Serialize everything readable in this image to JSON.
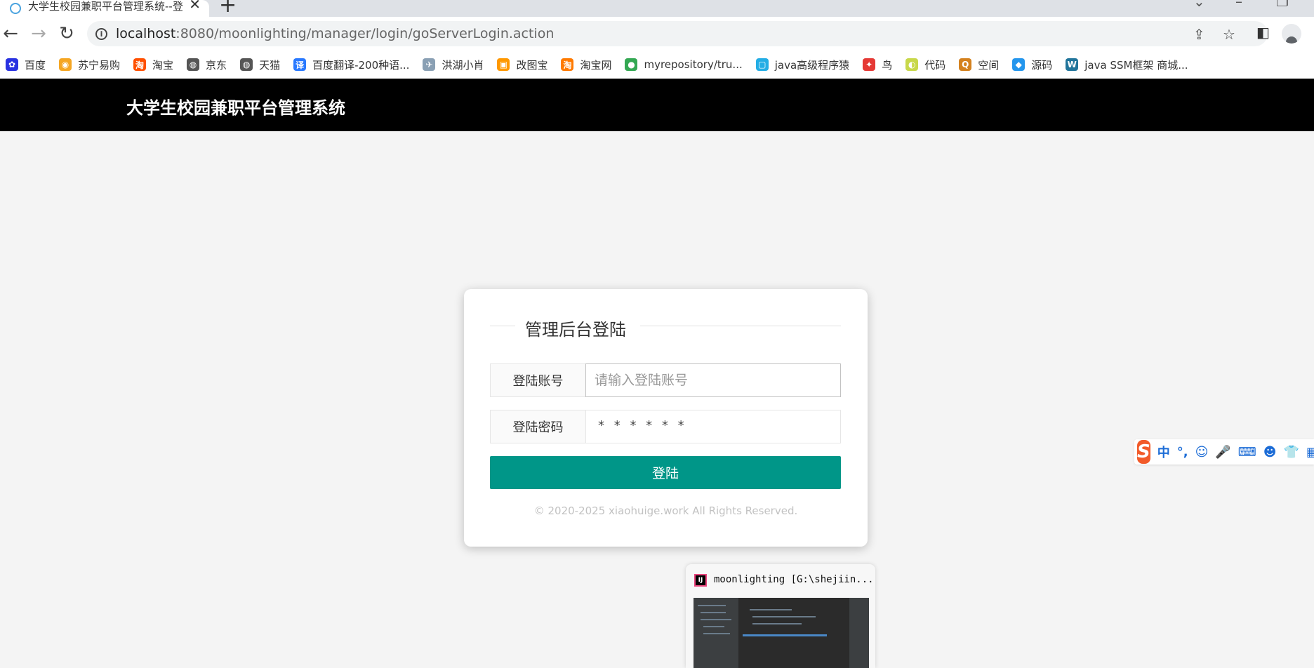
{
  "browser": {
    "tab_title": "大学生校园兼职平台管理系统--登",
    "tab_close": "✕",
    "new_tab": "+",
    "url_host": "localhost",
    "url_path": ":8080/moonlighting/manager/login/goServerLogin.action",
    "bookmarks": [
      {
        "label": "百度",
        "icon": "baidu-icon",
        "color": "#2932e1",
        "glyph": "✿"
      },
      {
        "label": "苏宁易购",
        "icon": "suning-icon",
        "color": "#f5a623",
        "glyph": "◉"
      },
      {
        "label": "淘宝",
        "icon": "taobao-icon",
        "color": "#ff5000",
        "glyph": "淘"
      },
      {
        "label": "京东",
        "icon": "globe-icon",
        "color": "#555555",
        "glyph": "◍"
      },
      {
        "label": "天猫",
        "icon": "globe-icon",
        "color": "#555555",
        "glyph": "◍"
      },
      {
        "label": "百度翻译-200种语...",
        "icon": "translate-icon",
        "color": "#2979ff",
        "glyph": "译"
      },
      {
        "label": "洪湖小肖",
        "icon": "bird-icon",
        "color": "#8aa0b4",
        "glyph": "✈"
      },
      {
        "label": "改图宝",
        "icon": "image-icon",
        "color": "#ff9800",
        "glyph": "▣"
      },
      {
        "label": "淘宝网",
        "icon": "taobao-icon",
        "color": "#ff7a00",
        "glyph": "淘"
      },
      {
        "label": "myrepository/tru...",
        "icon": "chrome-icon",
        "color": "#34a853",
        "glyph": "●"
      },
      {
        "label": "java高级程序猿",
        "icon": "bilibili-icon",
        "color": "#23ade5",
        "glyph": "▢"
      },
      {
        "label": "鸟",
        "icon": "bird-icon",
        "color": "#e53935",
        "glyph": "✦"
      },
      {
        "label": "代码",
        "icon": "code-icon",
        "color": "#c8d84a",
        "glyph": "◐"
      },
      {
        "label": "空间",
        "icon": "space-icon",
        "color": "#d4811e",
        "glyph": "Q"
      },
      {
        "label": "源码",
        "icon": "docker-icon",
        "color": "#2496ed",
        "glyph": "◆"
      },
      {
        "label": "java SSM框架 商城...",
        "icon": "wordpress-icon",
        "color": "#21759b",
        "glyph": "W"
      }
    ]
  },
  "header": {
    "title": "大学生校园兼职平台管理系统"
  },
  "login": {
    "legend": "管理后台登陆",
    "account_label": "登陆账号",
    "account_placeholder": "请输入登陆账号",
    "password_label": "登陆密码",
    "password_mask": "* * * * * *",
    "submit": "登陆",
    "copyright": "© 2020-2025 xiaohuige.work All Rights Reserved."
  },
  "ime": {
    "items": [
      "中",
      "°,",
      "☺",
      "🎤",
      "⌨",
      "☻",
      "👕",
      "▦"
    ]
  },
  "taskbar_preview": {
    "title": "moonlighting [G:\\shejiin...",
    "icon_text": "IJ"
  },
  "colors": {
    "header_bg": "#000000",
    "accent": "#009688",
    "page_bg": "#f4f4f4"
  }
}
